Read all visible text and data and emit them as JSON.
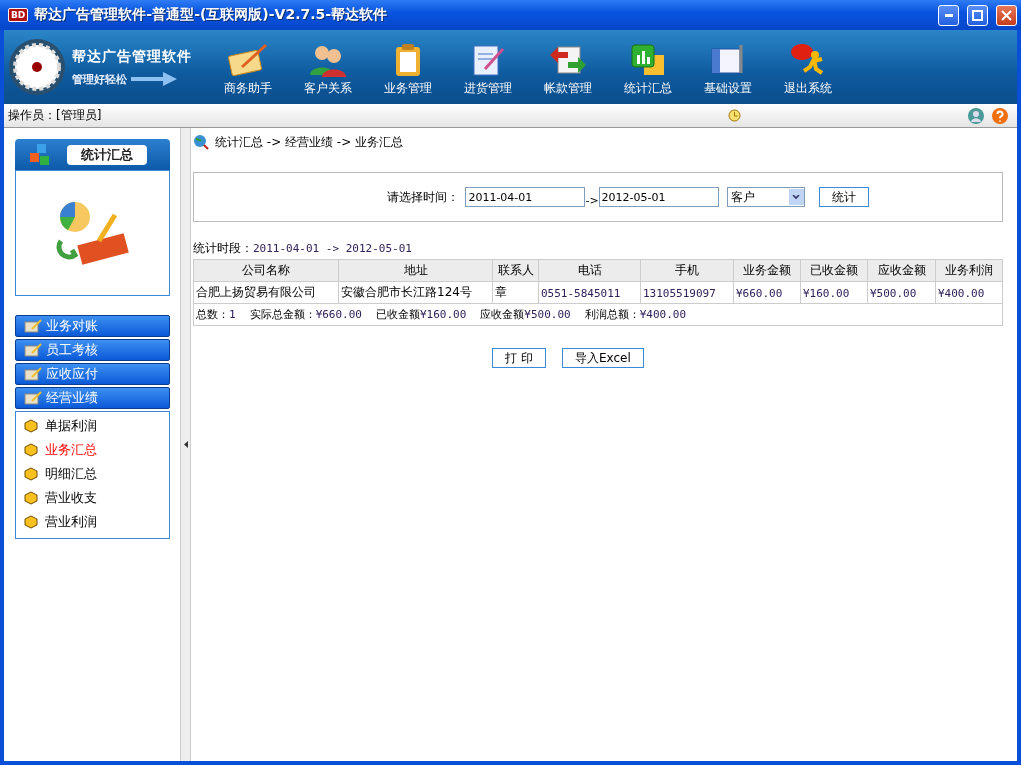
{
  "window": {
    "title": "帮达广告管理软件-普通型-(互联网版)-V2.7.5-帮达软件",
    "logo": "BD"
  },
  "brand": {
    "name": "帮达广告管理软件",
    "slogan": "管理好轻松"
  },
  "toolbar": [
    {
      "label": "商务助手",
      "kind": "notepad"
    },
    {
      "label": "客户关系",
      "kind": "people"
    },
    {
      "label": "业务管理",
      "kind": "clipboard"
    },
    {
      "label": "进货管理",
      "kind": "document"
    },
    {
      "label": "帐款管理",
      "kind": "transfer"
    },
    {
      "label": "统计汇总",
      "kind": "chart"
    },
    {
      "label": "基础设置",
      "kind": "settings"
    },
    {
      "label": "退出系统",
      "kind": "exit"
    }
  ],
  "status_bar": {
    "operator": "操作员：[管理员]"
  },
  "sidebar": {
    "header": "统计汇总",
    "groups": [
      {
        "label": "业务对账"
      },
      {
        "label": "员工考核"
      },
      {
        "label": "应收应付"
      },
      {
        "label": "经营业绩",
        "children": [
          {
            "label": "单据利润",
            "selected": false
          },
          {
            "label": "业务汇总",
            "selected": true
          },
          {
            "label": "明细汇总",
            "selected": false
          },
          {
            "label": "营业收支",
            "selected": false
          },
          {
            "label": "营业利润",
            "selected": false
          }
        ]
      }
    ]
  },
  "breadcrumb": "统计汇总 -> 经营业绩 -> 业务汇总",
  "filter": {
    "label": "请选择时间：",
    "from": "2011-04-01",
    "arrow": "->",
    "to": "2012-05-01",
    "group_by": "客户",
    "submit": "统计"
  },
  "period": {
    "label": "统计时段：",
    "value": "2011-04-01 -> 2012-05-01"
  },
  "table": {
    "columns": [
      "公司名称",
      "地址",
      "联系人",
      "电话",
      "手机",
      "业务金额",
      "已收金额",
      "应收金额",
      "业务利润"
    ],
    "rows": [
      [
        "合肥上扬贸易有限公司",
        "安徽合肥市长江路124号",
        "章",
        "0551-5845011",
        "13105519097",
        "¥660.00",
        "¥160.00",
        "¥500.00",
        "¥400.00"
      ]
    ],
    "summary": [
      {
        "label": "总数：",
        "value": "1"
      },
      {
        "label": "实际总金额：",
        "value": "¥660.00"
      },
      {
        "label": "已收金额",
        "value": "¥160.00"
      },
      {
        "label": "应收金额",
        "value": "¥500.00"
      },
      {
        "label": "利润总额：",
        "value": "¥400.00"
      }
    ]
  },
  "actions": [
    "打 印",
    "导入Excel"
  ]
}
